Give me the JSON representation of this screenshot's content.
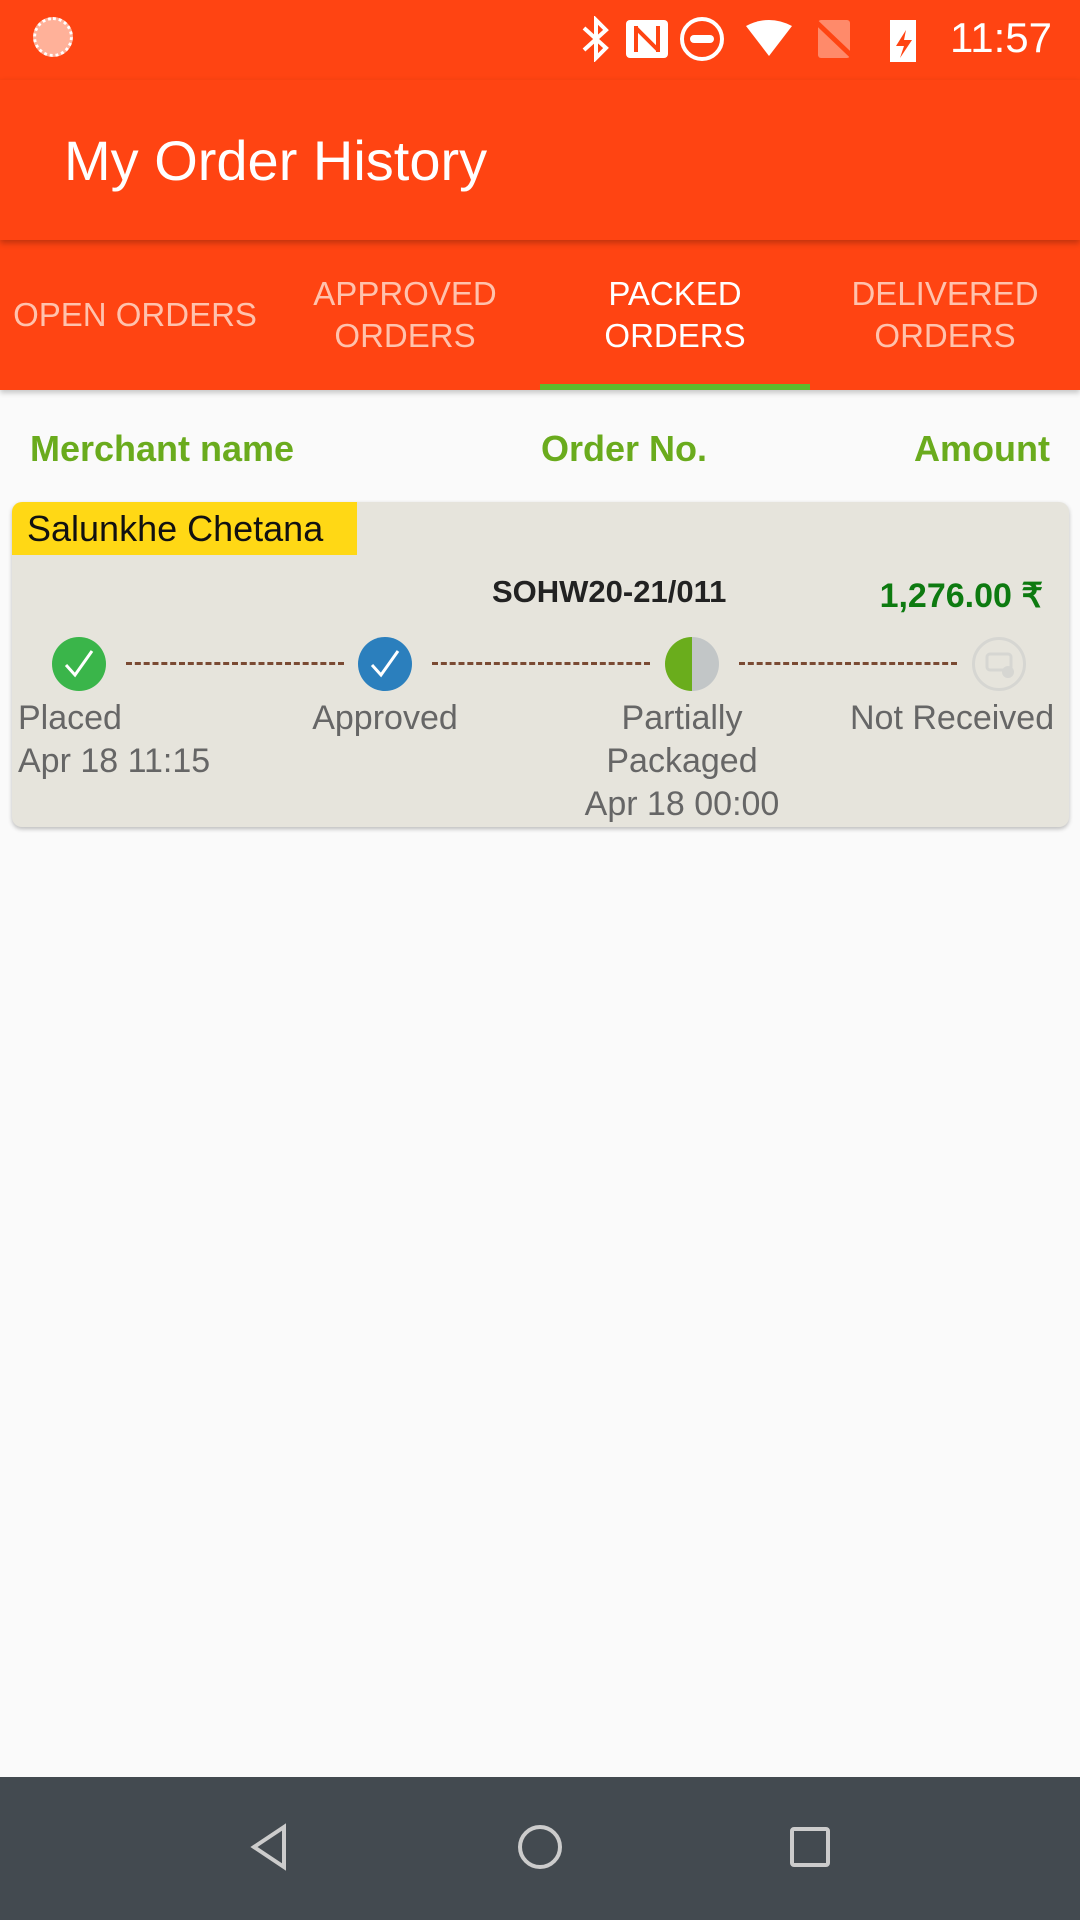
{
  "status_bar": {
    "time": "11:57",
    "icons": [
      "app-notification-icon",
      "bluetooth-icon",
      "nfc-icon",
      "do-not-disturb-icon",
      "wifi-icon",
      "no-sim-icon",
      "battery-charging-icon"
    ]
  },
  "app_bar": {
    "title": "My Order History"
  },
  "tabs": [
    {
      "label": "OPEN ORDERS",
      "active": false
    },
    {
      "label": "APPROVED ORDERS",
      "active": false
    },
    {
      "label": "PACKED ORDERS",
      "active": true
    },
    {
      "label": "DELIVERED ORDERS",
      "active": false
    }
  ],
  "list_header": {
    "merchant": "Merchant name",
    "order_no": "Order No.",
    "amount": "Amount"
  },
  "orders": [
    {
      "merchant": "Salunkhe Chetana",
      "order_no": "SOHW20-21/011",
      "amount": "1,276.00 ₹",
      "steps": [
        {
          "label": "Placed",
          "date": "Apr 18 11:15",
          "state": "done"
        },
        {
          "label": "Approved",
          "date": "",
          "state": "done"
        },
        {
          "label": "Partially Packaged",
          "line1": "Partially",
          "line2": "Packaged",
          "date": "Apr 18 00:00",
          "state": "partial"
        },
        {
          "label": "Not Received",
          "date": "",
          "state": "pending"
        }
      ]
    }
  ],
  "colors": {
    "primary": "#ff4412",
    "accent": "#5fba2c",
    "merchant_badge": "#ffd815",
    "amount": "#0d7a10"
  },
  "nav_bar": {
    "buttons": [
      "back",
      "home",
      "recents"
    ]
  }
}
